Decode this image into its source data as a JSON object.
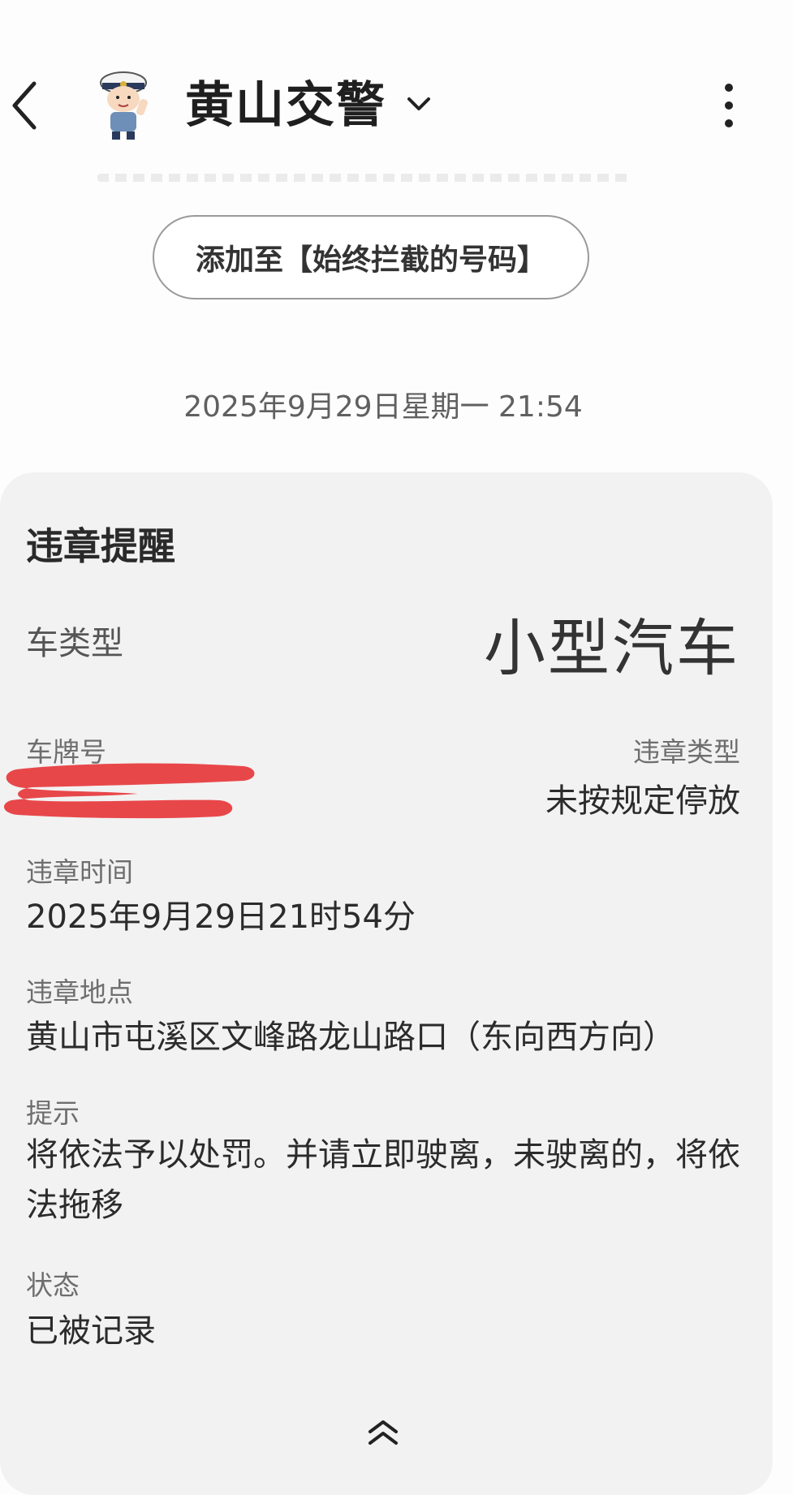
{
  "header": {
    "title": "黄山交警",
    "back_icon": "chevron-left-icon",
    "dropdown_icon": "chevron-down-icon",
    "more_icon": "more-vertical-icon",
    "avatar_icon": "traffic-police-avatar-icon"
  },
  "block_button_label": "添加至【始终拦截的号码】",
  "message": {
    "timestamp": "2025年9月29日星期一 21:54"
  },
  "card": {
    "title": "违章提醒",
    "vehicle_type_label": "车类型",
    "vehicle_type_value": "小型汽车",
    "plate_label": "车牌号",
    "violation_type_label": "违章类型",
    "violation_type_value": "未按规定停放",
    "time_label": "违章时间",
    "time_value": "2025年9月29日21时54分",
    "location_label": "违章地点",
    "location_value": "黄山市屯溪区文峰路龙山路口（东向西方向）",
    "tip_label": "提示",
    "tip_value": "将依法予以处罚。并请立即驶离，未驶离的，将依法拖移",
    "status_label": "状态",
    "status_value": "已被记录",
    "expand_icon": "double-chevron-up-icon"
  },
  "colors": {
    "redaction": "#e8474a",
    "card_background": "#f2f2f2"
  }
}
